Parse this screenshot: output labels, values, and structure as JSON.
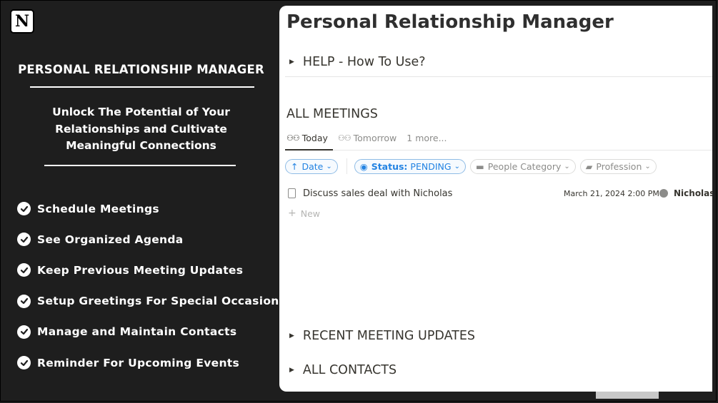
{
  "left_panel": {
    "logo_letter": "N",
    "title": "PERSONAL RELATIONSHIP MANAGER",
    "tagline_lines": [
      "Unlock The Potential of Your",
      "Relationships and Cultivate",
      "Meaningful Connections"
    ],
    "features": [
      "Schedule Meetings",
      "See Organized Agenda",
      "Keep Previous Meeting Updates",
      "Setup Greetings For Special Occasions",
      "Manage and Maintain Contacts",
      "Reminder For Upcoming Events"
    ]
  },
  "notion": {
    "page_title": "Personal Relationship Manager",
    "help_toggle": "HELP - How To Use?",
    "database_title": "ALL MEETINGS",
    "tabs": [
      {
        "label": "Today",
        "active": true
      },
      {
        "label": "Tomorrow",
        "active": false
      },
      {
        "label": "1 more...",
        "active": false
      }
    ],
    "filters": {
      "sort": "Date",
      "status_label": "Status:",
      "status_value": "PENDING",
      "people_category": "People Category",
      "profession": "Profession"
    },
    "rows": [
      {
        "title": "Discuss sales deal with Nicholas",
        "date": "March 21, 2024 2:00 PM",
        "person": "Nicholas W"
      }
    ],
    "new_label": "New",
    "recent_toggle": "RECENT MEETING UPDATES",
    "contacts_toggle": "ALL CONTACTS"
  },
  "colors": {
    "background": "#1e1e1e",
    "accent_blue": "#2383e2",
    "text": "#37352f"
  }
}
